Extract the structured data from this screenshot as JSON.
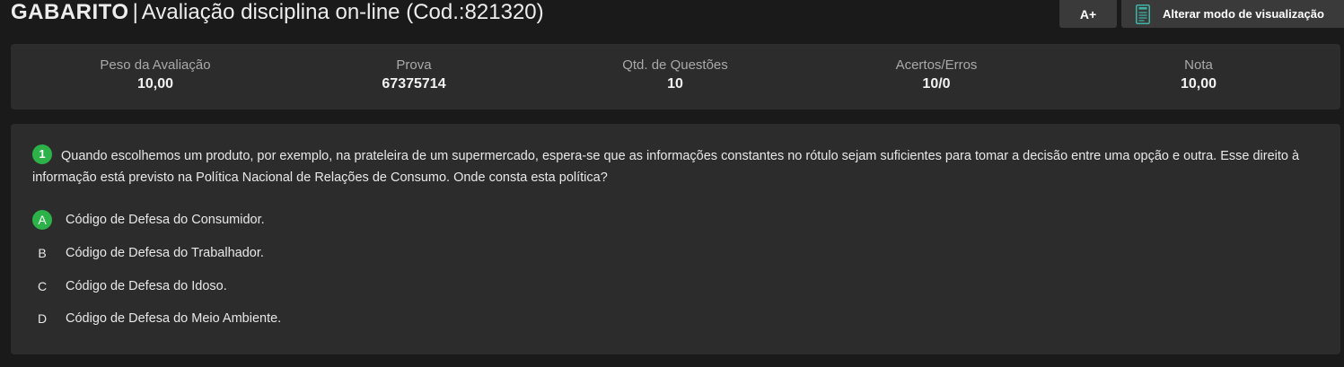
{
  "header": {
    "title_strong": "GABARITO",
    "title_separator": "|",
    "title_rest": "Avaliação disciplina on-line (Cod.:821320)",
    "font_size_button": "A+",
    "view_mode_button": "Alterar modo de visualização",
    "view_mode_icon": "document-icon"
  },
  "stats": [
    {
      "label": "Peso da Avaliação",
      "value": "10,00"
    },
    {
      "label": "Prova",
      "value": "67375714"
    },
    {
      "label": "Qtd. de Questões",
      "value": "10"
    },
    {
      "label": "Acertos/Erros",
      "value": "10/0"
    },
    {
      "label": "Nota",
      "value": "10,00"
    }
  ],
  "question": {
    "number": "1",
    "text": "Quando escolhemos um produto, por exemplo, na prateleira de um supermercado, espera-se que as informações constantes no rótulo sejam suficientes para tomar a decisão entre uma opção e outra. Esse direito à informação está previsto na Política Nacional de Relações de Consumo. Onde consta esta política?",
    "options": [
      {
        "letter": "A",
        "text": "Código de Defesa do Consumidor.",
        "correct": true
      },
      {
        "letter": "B",
        "text": "Código de Defesa do Trabalhador.",
        "correct": false
      },
      {
        "letter": "C",
        "text": "Código de Defesa do Idoso.",
        "correct": false
      },
      {
        "letter": "D",
        "text": "Código de Defesa do Meio Ambiente.",
        "correct": false
      }
    ]
  },
  "colors": {
    "background": "#1a1a1a",
    "panel": "#2c2c2c",
    "button": "#3a3a3a",
    "correct_green": "#2db24a"
  }
}
